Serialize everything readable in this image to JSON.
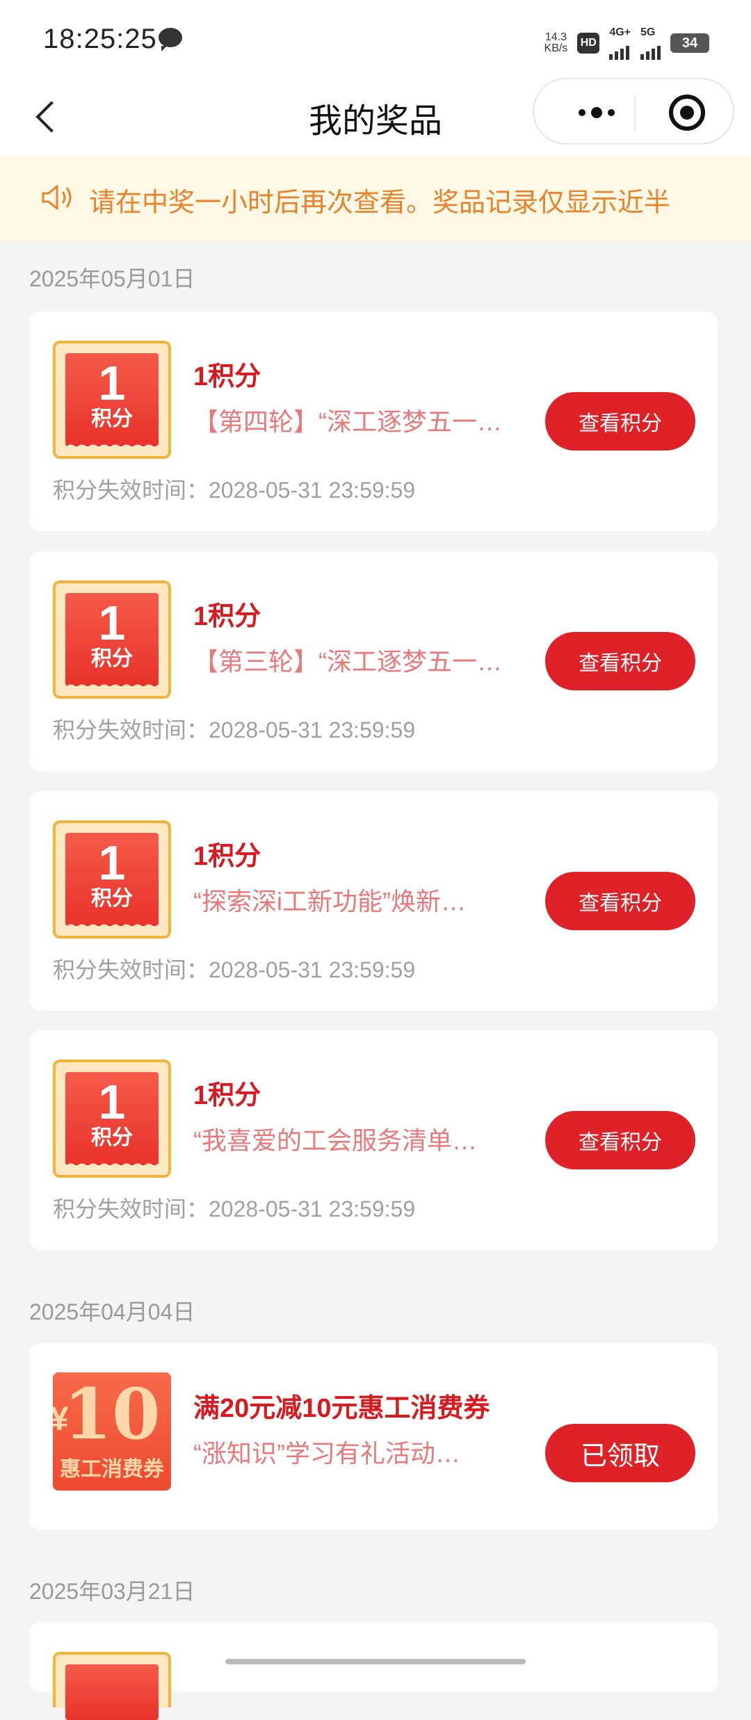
{
  "status": {
    "time": "18:25:25",
    "speed_value": "14.3",
    "speed_unit": "KB/s",
    "hd": "HD",
    "net1": "4G+",
    "net2": "5G",
    "battery": "34"
  },
  "nav": {
    "title": "我的奖品"
  },
  "notice": {
    "text": "请在中奖一小时后再次查看。奖品记录仅显示近半"
  },
  "groups": [
    {
      "date": "2025年05月01日"
    },
    {
      "date": "2025年04月04日"
    },
    {
      "date": "2025年03月21日"
    }
  ],
  "cards": [
    {
      "badge_num": "1",
      "badge_unit": "积分",
      "title": "1积分",
      "desc": "【第四轮】“深工逐梦五一…",
      "button": "查看积分",
      "expiry": "积分失效时间：2028-05-31 23:59:59"
    },
    {
      "badge_num": "1",
      "badge_unit": "积分",
      "title": "1积分",
      "desc": "【第三轮】“深工逐梦五一…",
      "button": "查看积分",
      "expiry": "积分失效时间：2028-05-31 23:59:59"
    },
    {
      "badge_num": "1",
      "badge_unit": "积分",
      "title": "1积分",
      "desc": "“探索深i工新功能”焕新…",
      "button": "查看积分",
      "expiry": "积分失效时间：2028-05-31 23:59:59"
    },
    {
      "badge_num": "1",
      "badge_unit": "积分",
      "title": "1积分",
      "desc": "“我喜爱的工会服务清单…",
      "button": "查看积分",
      "expiry": "积分失效时间：2028-05-31 23:59:59"
    }
  ],
  "coupon_card": {
    "yen": "¥",
    "num": "10",
    "label": "惠工消费券",
    "title": "满20元减10元惠工消费券",
    "desc": "“涨知识”学习有礼活动…",
    "button": "已领取"
  },
  "colors": {
    "accent": "#df2228",
    "notice_text": "#e8822c",
    "badge_border": "#f0b43c"
  }
}
